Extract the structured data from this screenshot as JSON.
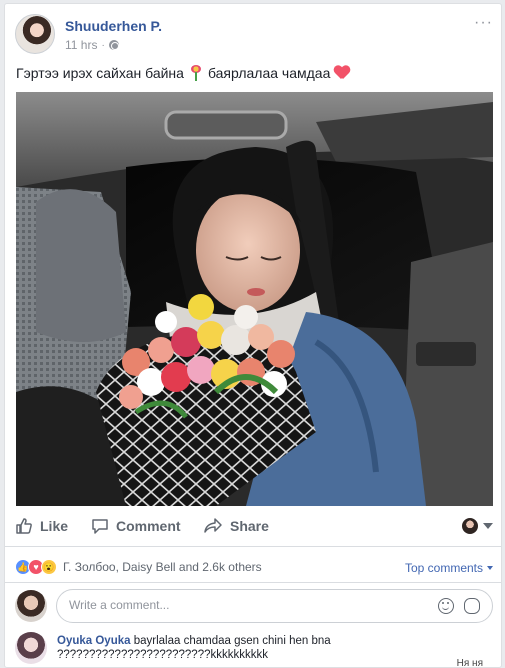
{
  "post": {
    "author": "Shuuderhen P.",
    "time": "11 hrs",
    "separator": "·",
    "more": "···",
    "caption_part1": "Гэртээ ирэх сайхан байна",
    "caption_part2": "баярлалаа чамдаа"
  },
  "actions": {
    "like": "Like",
    "comment": "Comment",
    "share": "Share"
  },
  "reactions": {
    "summary": "Г. Золбоо, Daisy Bell and 2.6k others",
    "sort_label": "Top comments"
  },
  "composer": {
    "placeholder": "Write a comment..."
  },
  "comments": [
    {
      "author": "Oyuka Oyuka",
      "text": "bayrlalaa chamdaa gsen chini hen bna ????????????????????????kkkkkkkkkk"
    }
  ],
  "footer": {
    "right_text": "Ня ня"
  },
  "colors": {
    "link": "#365899",
    "accent": "#4267b2",
    "muted": "#606770",
    "love": "#f25268",
    "like": "#5890ff"
  }
}
